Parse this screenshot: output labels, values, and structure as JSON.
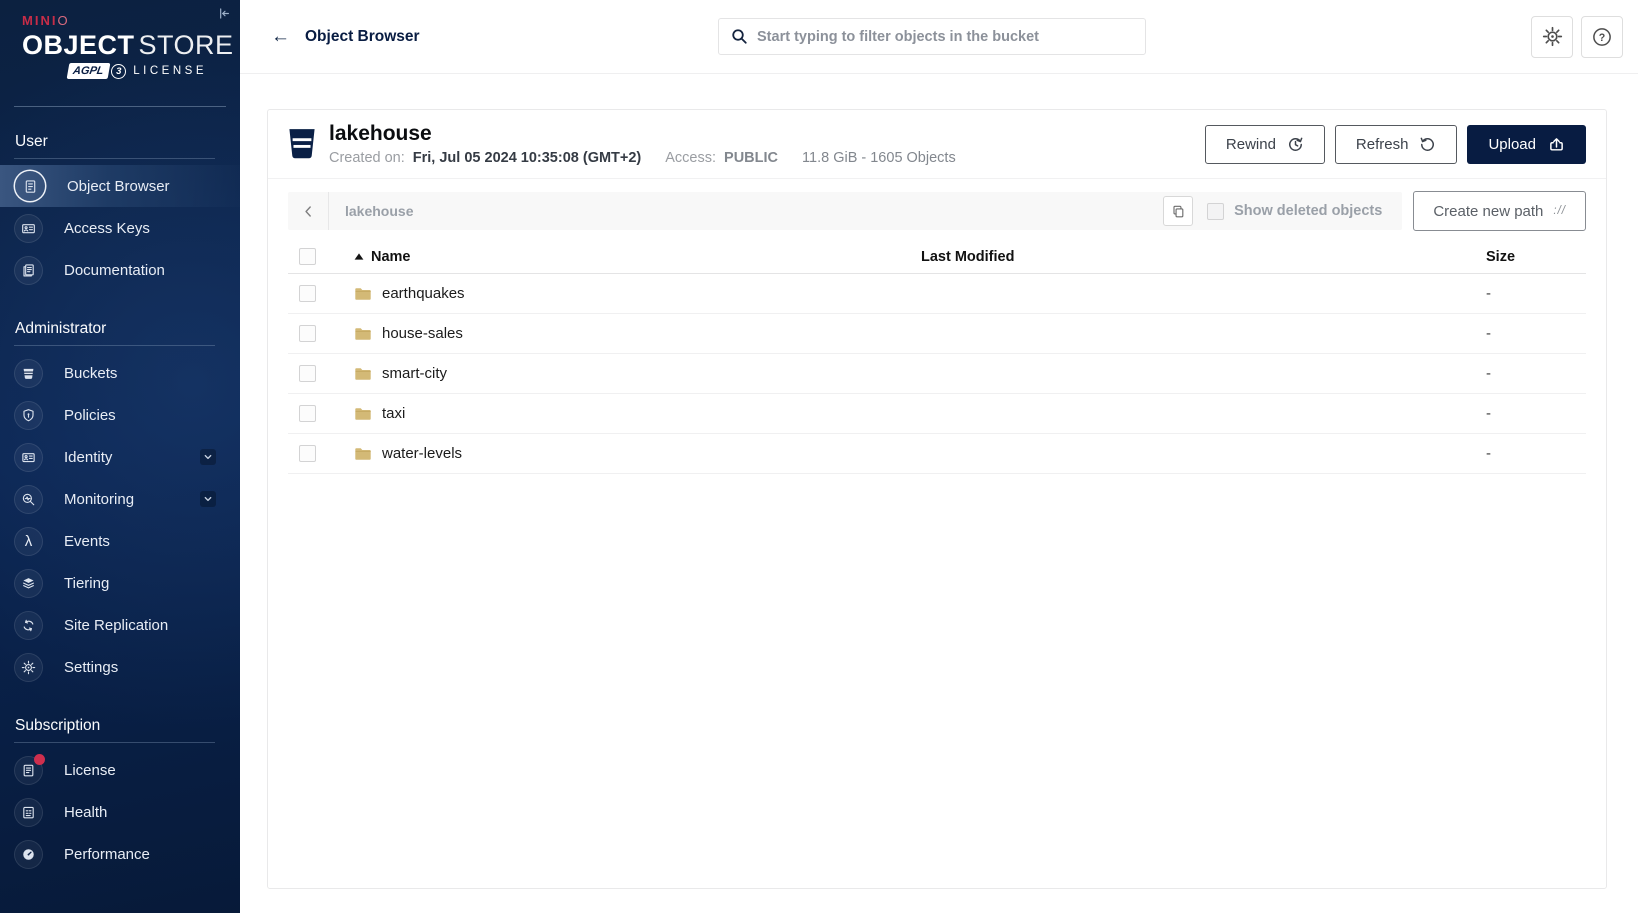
{
  "brand": {
    "minio_solid": "MINI",
    "minio_outline": "O",
    "title_bold": "OBJECT",
    "title_light": "STORE",
    "badge": "AGPL",
    "badge_version": "3",
    "license": "LICENSE",
    "red": "#c72c48",
    "navy": "#081c42"
  },
  "sidebar": {
    "sections": [
      {
        "label": "User",
        "items": [
          {
            "label": "Object Browser",
            "icon": "object-browser-icon",
            "active": true
          },
          {
            "label": "Access Keys",
            "icon": "access-keys-icon"
          },
          {
            "label": "Documentation",
            "icon": "documentation-icon"
          }
        ]
      },
      {
        "label": "Administrator",
        "items": [
          {
            "label": "Buckets",
            "icon": "buckets-icon"
          },
          {
            "label": "Policies",
            "icon": "policies-icon"
          },
          {
            "label": "Identity",
            "icon": "identity-icon",
            "chevron": true
          },
          {
            "label": "Monitoring",
            "icon": "monitoring-icon",
            "chevron": true
          },
          {
            "label": "Events",
            "icon": "events-icon"
          },
          {
            "label": "Tiering",
            "icon": "tiering-icon"
          },
          {
            "label": "Site Replication",
            "icon": "site-replication-icon"
          },
          {
            "label": "Settings",
            "icon": "settings-icon"
          }
        ]
      },
      {
        "label": "Subscription",
        "items": [
          {
            "label": "License",
            "icon": "license-icon",
            "badge_dot": true
          },
          {
            "label": "Health",
            "icon": "health-icon"
          },
          {
            "label": "Performance",
            "icon": "performance-icon"
          }
        ]
      }
    ]
  },
  "topbar": {
    "back_icon": "←",
    "title": "Object Browser",
    "search_placeholder": "Start typing to filter objects in the bucket"
  },
  "bucket": {
    "name": "lakehouse",
    "created_label": "Created on:",
    "created_value": "Fri, Jul 05 2024 10:35:08 (GMT+2)",
    "access_label": "Access:",
    "access_value": "PUBLIC",
    "stats": "11.8 GiB - 1605 Objects",
    "rewind_label": "Rewind",
    "refresh_label": "Refresh",
    "upload_label": "Upload"
  },
  "pathbar": {
    "current_path": "lakehouse",
    "show_deleted_label": "Show deleted objects",
    "show_deleted_checked": false,
    "create_path_label": "Create new path",
    "create_path_icon": "://"
  },
  "table": {
    "headers": {
      "name": "Name",
      "last_modified": "Last Modified",
      "size": "Size"
    },
    "sort": {
      "column": "Name",
      "direction": "asc"
    },
    "rows": [
      {
        "name": "earthquakes",
        "last_modified": "",
        "size": "-"
      },
      {
        "name": "house-sales",
        "last_modified": "",
        "size": "-"
      },
      {
        "name": "smart-city",
        "last_modified": "",
        "size": "-"
      },
      {
        "name": "taxi",
        "last_modified": "",
        "size": "-"
      },
      {
        "name": "water-levels",
        "last_modified": "",
        "size": "-"
      }
    ]
  }
}
